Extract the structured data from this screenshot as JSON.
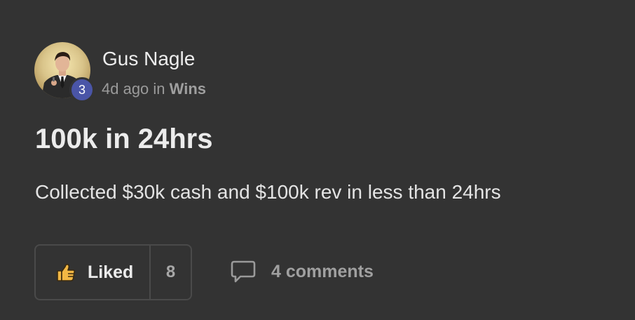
{
  "post": {
    "author": {
      "name": "Gus Nagle",
      "level": "3"
    },
    "time_ago": "4d ago",
    "in_text": "in",
    "category": "Wins",
    "title": "100k in 24hrs",
    "body": "Collected $30k cash and $100k rev in less than 24hrs",
    "actions": {
      "like_label": "Liked",
      "like_count": "8",
      "comments_label": "4 comments"
    }
  },
  "icons": {
    "like": "thumbs-up-icon",
    "comments": "speech-bubble-icon"
  },
  "colors": {
    "background": "#333333",
    "level_badge": "#4a55a7",
    "thumb_fill": "#f2b744",
    "muted_text": "#9a9a9a"
  }
}
